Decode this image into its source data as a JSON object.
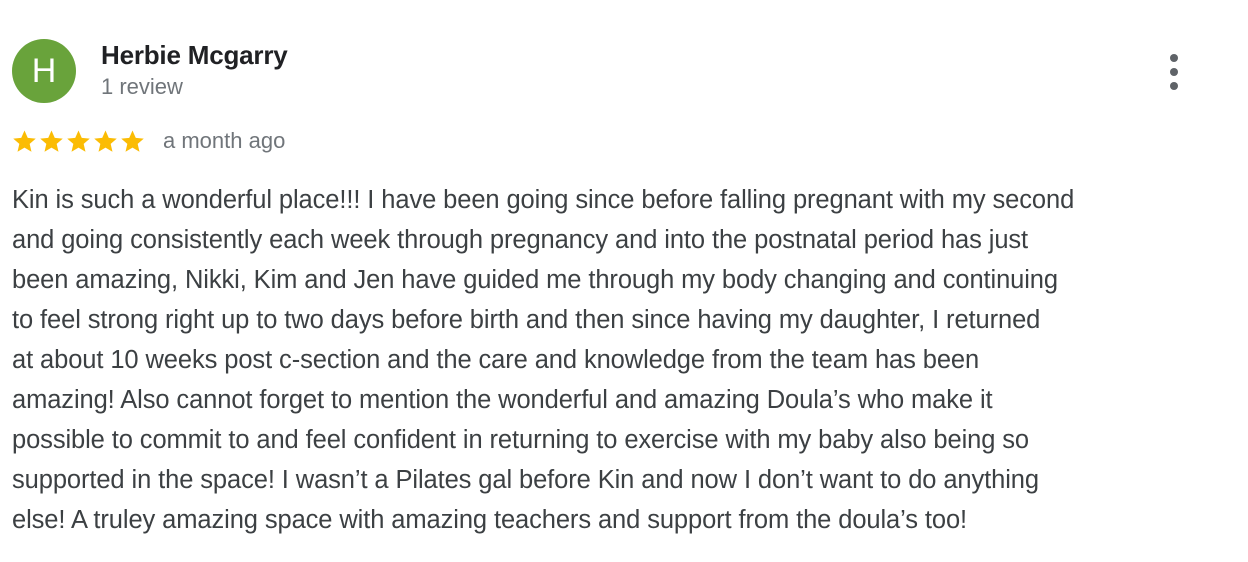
{
  "review": {
    "author": {
      "initial": "H",
      "name": "Herbie Mcgarry",
      "meta": "1 review",
      "avatar_color": "#69a33b"
    },
    "more_options_icon": "vertical-ellipsis-icon",
    "rating": {
      "stars": 5,
      "max_stars": 5,
      "star_color": "#fbbc04",
      "star_icon": "star-icon"
    },
    "date": "a month ago",
    "text": "Kin is such a wonderful place!!! I have been going since before falling pregnant with my second\nand going consistently each week through pregnancy and into the postnatal period has just\nbeen amazing, Nikki, Kim and Jen have guided me through my body changing and continuing\nto feel strong right up to two days before birth and then since having my daughter, I returned\nat about 10 weeks post c-section and the care and knowledge from the team has been\namazing! Also cannot forget to mention the wonderful and amazing Doula’s who make it\npossible to commit to and feel confident in returning to exercise with my baby also being so\nsupported in the space! I wasn’t a Pilates gal before Kin and now I don’t want to do anything\nelse! A truley amazing space with amazing teachers and support from the doula’s too!"
  }
}
